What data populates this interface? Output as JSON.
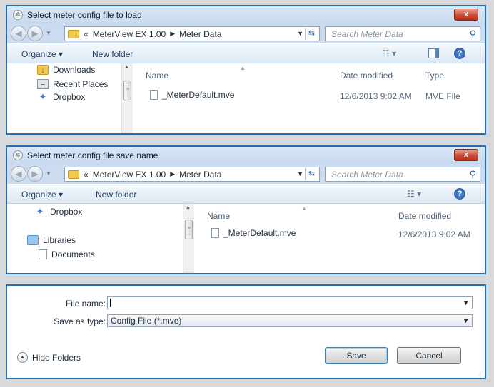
{
  "dialog_load": {
    "title": "Select meter config file to load",
    "close": "x",
    "address": {
      "chevron": "«",
      "crumb1": "MeterView EX 1.00",
      "crumb2": "Meter Data"
    },
    "search_placeholder": "Search Meter Data",
    "toolbar": {
      "organize": "Organize ▾",
      "new_folder": "New folder"
    },
    "nav_items": [
      "Downloads",
      "Recent Places",
      "Dropbox"
    ],
    "columns": {
      "name": "Name",
      "date": "Date modified",
      "type": "Type"
    },
    "file": {
      "name": "_MeterDefault.mve",
      "date": "12/6/2013 9:02 AM",
      "type": "MVE File"
    }
  },
  "dialog_save": {
    "title": "Select meter config file save name",
    "close": "x",
    "address": {
      "chevron": "«",
      "crumb1": "MeterView EX 1.00",
      "crumb2": "Meter Data"
    },
    "search_placeholder": "Search Meter Data",
    "toolbar": {
      "organize": "Organize ▾",
      "new_folder": "New folder"
    },
    "nav_items": [
      "Dropbox",
      "Libraries",
      "Documents"
    ],
    "columns": {
      "name": "Name",
      "date": "Date modified"
    },
    "file": {
      "name": "_MeterDefault.mve",
      "date": "12/6/2013 9:02 AM"
    }
  },
  "save_form": {
    "file_name_label": "File name:",
    "file_name_value": "",
    "save_as_type_label": "Save as type:",
    "save_as_type_value": "Config File (*.mve)",
    "hide_folders": "Hide Folders",
    "save_button": "Save",
    "cancel_button": "Cancel"
  }
}
